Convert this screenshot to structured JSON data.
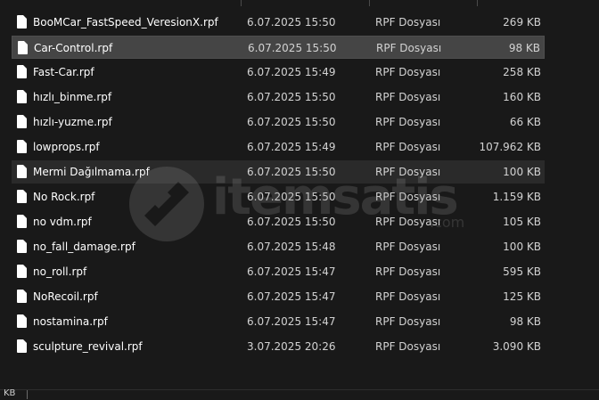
{
  "files": [
    {
      "name": "BooMCar_FastSpeed_VeresionX.rpf",
      "date": "6.07.2025 15:50",
      "type": "RPF Dosyası",
      "size": "269 KB",
      "state": ""
    },
    {
      "name": "Car-Control.rpf",
      "date": "6.07.2025 15:50",
      "type": "RPF Dosyası",
      "size": "98 KB",
      "state": "selected"
    },
    {
      "name": "Fast-Car.rpf",
      "date": "6.07.2025 15:49",
      "type": "RPF Dosyası",
      "size": "258 KB",
      "state": ""
    },
    {
      "name": "hızlı_binme.rpf",
      "date": "6.07.2025 15:50",
      "type": "RPF Dosyası",
      "size": "160 KB",
      "state": ""
    },
    {
      "name": "hızlı-yuzme.rpf",
      "date": "6.07.2025 15:50",
      "type": "RPF Dosyası",
      "size": "66 KB",
      "state": ""
    },
    {
      "name": "lowprops.rpf",
      "date": "6.07.2025 15:49",
      "type": "RPF Dosyası",
      "size": "107.962 KB",
      "state": ""
    },
    {
      "name": "Mermi Dağılmama.rpf",
      "date": "6.07.2025 15:50",
      "type": "RPF Dosyası",
      "size": "100 KB",
      "state": "hover"
    },
    {
      "name": "No Rock.rpf",
      "date": "6.07.2025 15:50",
      "type": "RPF Dosyası",
      "size": "1.159 KB",
      "state": ""
    },
    {
      "name": "no vdm.rpf",
      "date": "6.07.2025 15:50",
      "type": "RPF Dosyası",
      "size": "105 KB",
      "state": ""
    },
    {
      "name": "no_fall_damage.rpf",
      "date": "6.07.2025 15:48",
      "type": "RPF Dosyası",
      "size": "100 KB",
      "state": ""
    },
    {
      "name": "no_roll.rpf",
      "date": "6.07.2025 15:47",
      "type": "RPF Dosyası",
      "size": "595 KB",
      "state": ""
    },
    {
      "name": "NoRecoil.rpf",
      "date": "6.07.2025 15:47",
      "type": "RPF Dosyası",
      "size": "125 KB",
      "state": ""
    },
    {
      "name": "nostamina.rpf",
      "date": "6.07.2025 15:47",
      "type": "RPF Dosyası",
      "size": "98 KB",
      "state": ""
    },
    {
      "name": "sculpture_revival.rpf",
      "date": "3.07.2025 20:26",
      "type": "RPF Dosyası",
      "size": "3.090 KB",
      "state": ""
    }
  ],
  "status_bar": {
    "text": "KB"
  },
  "watermark": {
    "text": "itemsatis",
    "com": ".com"
  },
  "colors": {
    "background": "#191919",
    "selected": "#454545",
    "hover": "#2a2a2a",
    "text": "#ffffff",
    "subtext": "#d2d2d2"
  }
}
